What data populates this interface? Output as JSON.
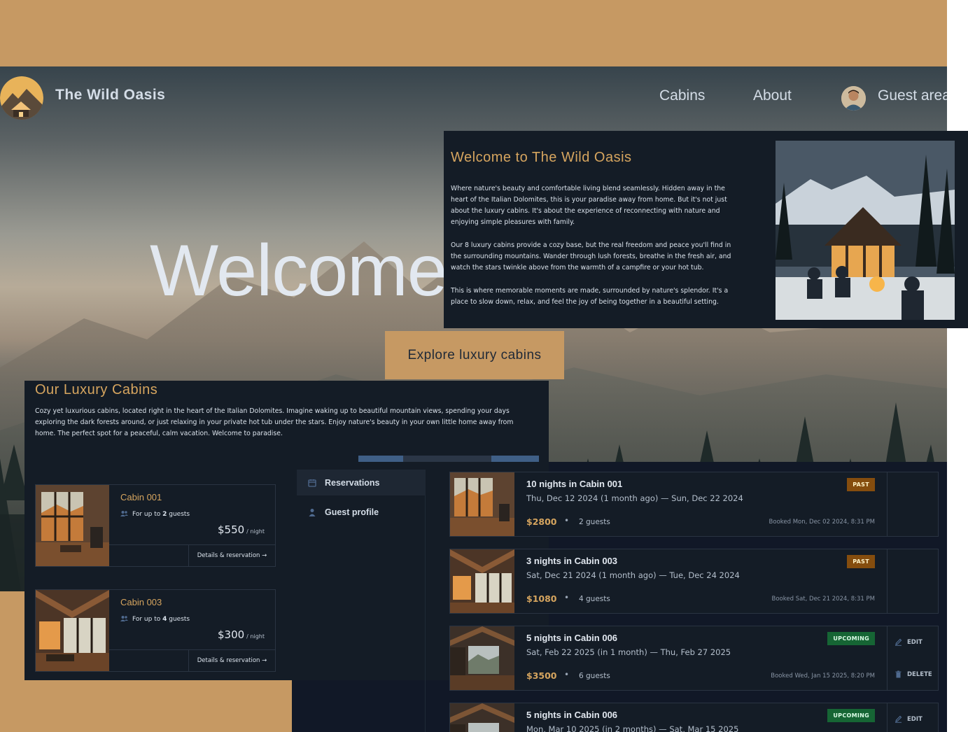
{
  "navbar": {
    "brand": "The Wild Oasis",
    "links": [
      "Cabins",
      "About"
    ],
    "guest_area": "Guest area"
  },
  "hero": {
    "title": "Welcome",
    "cta": "Explore luxury cabins"
  },
  "about": {
    "title": "Welcome to The Wild Oasis",
    "paragraphs": [
      "Where nature's beauty and comfortable living blend seamlessly. Hidden away in the heart of the Italian Dolomites, this is your paradise away from home. But it's not just about the luxury cabins. It's about the experience of reconnecting with nature and enjoying simple pleasures with family.",
      "Our 8 luxury cabins provide a cozy base, but the real freedom and peace you'll find in the surrounding mountains. Wander through lush forests, breathe in the fresh air, and watch the stars twinkle above from the warmth of a campfire or your hot tub.",
      "This is where memorable moments are made, surrounded by nature's splendor. It's a place to slow down, relax, and feel the joy of being together in a beautiful setting."
    ]
  },
  "cabins_section": {
    "title": "Our Luxury Cabins",
    "description": "Cozy yet luxurious cabins, located right in the heart of the Italian Dolomites. Imagine waking up to beautiful mountain views, spending your days exploring the dark forests around, or just relaxing in your private hot tub under the stars. Enjoy nature's beauty in your own little home away from home. The perfect spot for a peaceful, calm vacation. Welcome to paradise.",
    "cabins": [
      {
        "name": "Cabin 001",
        "capacity_prefix": "For up to ",
        "capacity_num": "2",
        "capacity_suffix": " guests",
        "price": "$550",
        "per_night": "/ night",
        "details": "Details & reservation →"
      },
      {
        "name": "Cabin 003",
        "capacity_prefix": "For up to ",
        "capacity_num": "4",
        "capacity_suffix": " guests",
        "price": "$300",
        "per_night": "/ night",
        "details": "Details & reservation →"
      }
    ]
  },
  "account_nav": {
    "items": [
      "Reservations",
      "Guest profile"
    ]
  },
  "reservations": [
    {
      "title": "10 nights in Cabin 001",
      "dates": "Thu, Dec 12 2024 (1 month ago) — Sun, Dec 22 2024",
      "price": "$2800",
      "guests": "2 guests",
      "booked": "Booked Mon, Dec 02 2024, 8:31 PM",
      "status": "PAST"
    },
    {
      "title": "3 nights in Cabin 003",
      "dates": "Sat, Dec 21 2024 (1 month ago) — Tue, Dec 24 2024",
      "price": "$1080",
      "guests": "4 guests",
      "booked": "Booked Sat, Dec 21 2024, 8:31 PM",
      "status": "PAST"
    },
    {
      "title": "5 nights in Cabin 006",
      "dates": "Sat, Feb 22 2025 (in 1 month) — Thu, Feb 27 2025",
      "price": "$3500",
      "guests": "6 guests",
      "booked": "Booked Wed, Jan 15 2025, 8:20 PM",
      "status": "UPCOMING",
      "edit": "EDIT",
      "delete": "DELETE"
    },
    {
      "title": "5 nights in Cabin 006",
      "dates": "Mon, Mar 10 2025 (in 2 months) — Sat, Mar 15 2025",
      "status": "UPCOMING",
      "edit": "EDIT"
    }
  ],
  "separator": "•",
  "colors": {
    "accent": "#c69963",
    "panel": "#141c26",
    "past_badge": "#854d0e",
    "upcoming_badge": "#166534"
  },
  "icons": [
    "users-icon",
    "calendar-icon",
    "user-icon",
    "pencil-icon",
    "trash-icon"
  ]
}
